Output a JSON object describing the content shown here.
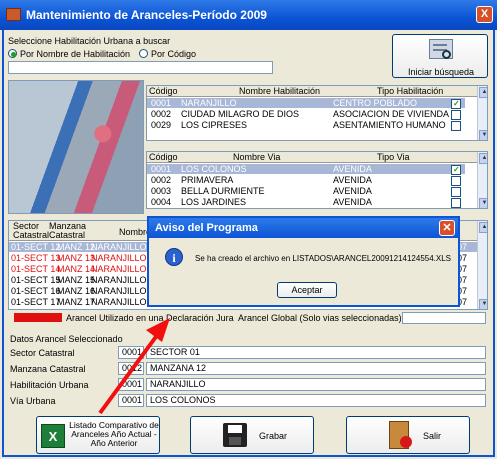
{
  "window": {
    "title": "Mantenimiento de Aranceles-Período 2009",
    "close": "X"
  },
  "search": {
    "group_label": "Seleccione Habilitación Urbana a buscar",
    "option_name": "Por Nombre de Habilitación",
    "option_code": "Por Código",
    "input_value": "",
    "button_label": "Iniciar búsqueda"
  },
  "habilitaciones": {
    "headers": [
      "Código",
      "Nombre Habilitación",
      "Tipo Habilitación"
    ],
    "rows": [
      {
        "code": "0001",
        "name": "NARANJILLO",
        "type": "CENTRO POBLADO",
        "selected": true
      },
      {
        "code": "0002",
        "name": "CIUDAD MILAGRO DE DIOS",
        "type": "ASOCIACION DE VIVIENDA"
      },
      {
        "code": "0029",
        "name": "LOS CIPRESES",
        "type": "ASENTAMIENTO HUMANO"
      }
    ]
  },
  "vias": {
    "headers": [
      "Código",
      "Nombre Via",
      "Tipo Via"
    ],
    "rows": [
      {
        "code": "0001",
        "name": "LOS COLONOS",
        "type": "AVENIDA",
        "selected": true
      },
      {
        "code": "0002",
        "name": "PRIMAVERA",
        "type": "AVENIDA"
      },
      {
        "code": "0003",
        "name": "BELLA DURMIENTE",
        "type": "AVENIDA"
      },
      {
        "code": "0004",
        "name": "LOS JARDINES",
        "type": "AVENIDA"
      }
    ]
  },
  "sectores": {
    "headers": [
      "Sector Catastral",
      "Manzana Catastral",
      "Nombre"
    ],
    "rows": [
      {
        "sector": "01-SECT 12",
        "manzana": "MANZ 12",
        "nombre": "NARANJILLO",
        "tail": "07",
        "selected": true
      },
      {
        "sector": "01-SECT 13",
        "manzana": "MANZ 13",
        "nombre": "NARANJILLO",
        "tail": "07",
        "red": true
      },
      {
        "sector": "01-SECT 14",
        "manzana": "MANZ 14",
        "nombre": "NARANJILLO",
        "tail": "07",
        "red": true
      },
      {
        "sector": "01-SECT 15",
        "manzana": "MANZ 15",
        "nombre": "NARANJILLO",
        "tail": "07"
      },
      {
        "sector": "01-SECT 16",
        "manzana": "MANZ 16",
        "nombre": "NARANJILLO",
        "tail": "07"
      },
      {
        "sector": "01-SECT 17",
        "manzana": "MANZ 17",
        "nombre": "NARANJILLO",
        "tail": "07"
      }
    ]
  },
  "legend": {
    "text": "Arancel Utilizado en una Declaración Jura",
    "global": "Arancel Global (Solo vias seleccionadas)"
  },
  "datos": {
    "title": "Datos Arancel Seleccionado",
    "sector_label": "Sector Catastral",
    "sector_code": "0001",
    "sector_value": "SECTOR 01",
    "manzana_label": "Manzana Catastral",
    "manzana_code": "0012",
    "manzana_value": "MANZANA 12",
    "hab_label": "Habilitación Urbana",
    "hab_code": "0001",
    "hab_value": "NARANJILLO",
    "via_label": "Vía Urbana",
    "via_code": "0001",
    "via_value": "LOS COLONOS"
  },
  "buttons": {
    "listado": "Listado Comparativo de Aranceles Año Actual - Año Anterior",
    "grabar": "Grabar",
    "salir": "Salir"
  },
  "dialog": {
    "title": "Aviso del Programa",
    "message": "Se ha creado el archivo en LISTADOS\\ARANCEL20091214124554.XLS",
    "button": "Aceptar"
  },
  "colors": {
    "titlebar": "#0b54d6",
    "legend_red": "#e01010",
    "selection": "#a8b7d6"
  }
}
